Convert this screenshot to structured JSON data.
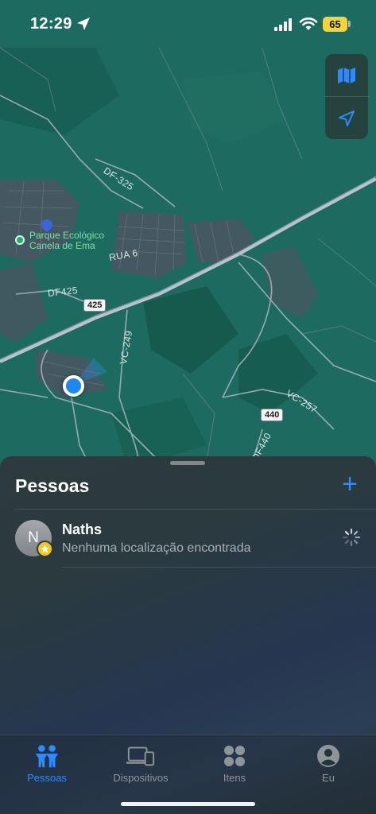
{
  "status_bar": {
    "time": "12:29",
    "battery": "65",
    "battery_color": "#f2d53c"
  },
  "map": {
    "labels": {
      "df325": "DF-325",
      "rua6": "RUA 6",
      "df425": "DF425",
      "vc249": "VC-249",
      "vc257": "VC-257",
      "df440": "DF440"
    },
    "shields": {
      "s425": "425",
      "s440": "440"
    },
    "poi": {
      "line1": "Parque Ecológico",
      "line2": "Canela de Ema"
    },
    "controls": [
      "map-icon",
      "location-arrow-icon"
    ]
  },
  "sheet": {
    "title": "Pessoas",
    "add_label": "+",
    "people": [
      {
        "initial": "N",
        "name": "Naths",
        "status": "Nenhuma localização encontrada"
      }
    ]
  },
  "tabbar": {
    "tabs": [
      {
        "label": "Pessoas",
        "icon": "people-icon",
        "active": true
      },
      {
        "label": "Dispositivos",
        "icon": "devices-icon",
        "active": false
      },
      {
        "label": "Itens",
        "icon": "items-icon",
        "active": false
      },
      {
        "label": "Eu",
        "icon": "profile-icon",
        "active": false
      }
    ]
  },
  "colors": {
    "accent": "#2c8cff",
    "map_green": "#1f6e63",
    "user_location": "#1e88f0",
    "star": "#f4c71f"
  }
}
